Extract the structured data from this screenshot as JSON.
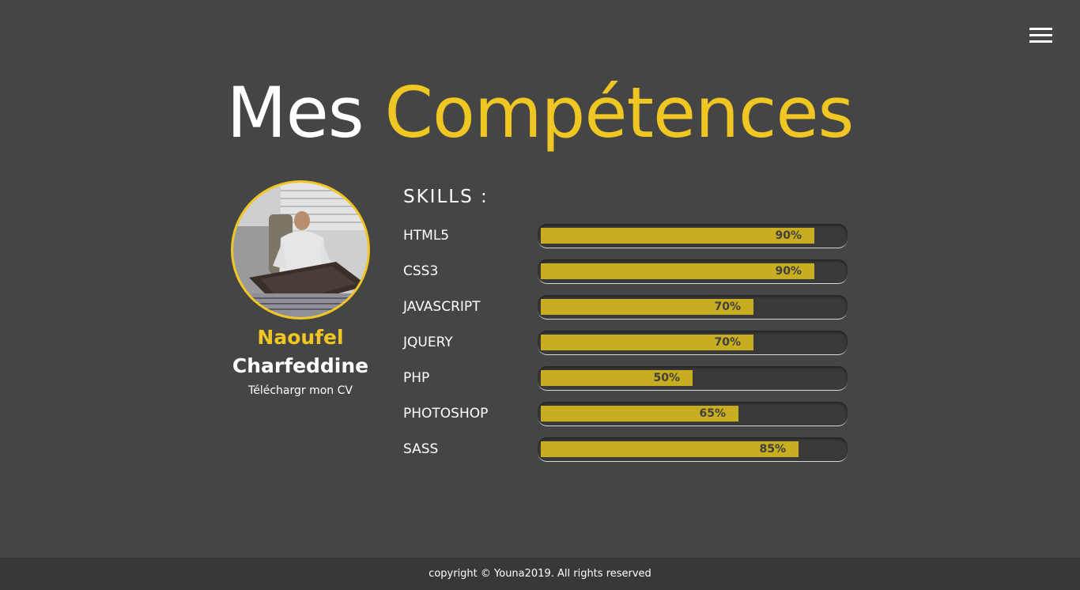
{
  "header": {
    "menu_icon": "hamburger-menu-icon",
    "title_part1": "Mes",
    "title_part2": "Compétences",
    "accent_color": "#f0c722"
  },
  "profile": {
    "first_name": "Naoufel",
    "last_name": "Charfeddine",
    "cv_link": "Téléchargr mon CV"
  },
  "skills": {
    "heading": "SKILLS :",
    "items": [
      {
        "name": "HTML5",
        "percent": 90,
        "label": "90%"
      },
      {
        "name": "CSS3",
        "percent": 90,
        "label": "90%"
      },
      {
        "name": "JAVASCRIPT",
        "percent": 70,
        "label": "70%"
      },
      {
        "name": "JQUERY",
        "percent": 70,
        "label": "70%"
      },
      {
        "name": "PHP",
        "percent": 50,
        "label": "50%"
      },
      {
        "name": "PHOTOSHOP",
        "percent": 65,
        "label": "65%"
      },
      {
        "name": "SASS",
        "percent": 85,
        "label": "85%"
      }
    ],
    "bar_color": "#c9ad20",
    "track_color": "#3a3a3a"
  },
  "footer": {
    "text": "copyright © Youna2019. All rights reserved"
  }
}
